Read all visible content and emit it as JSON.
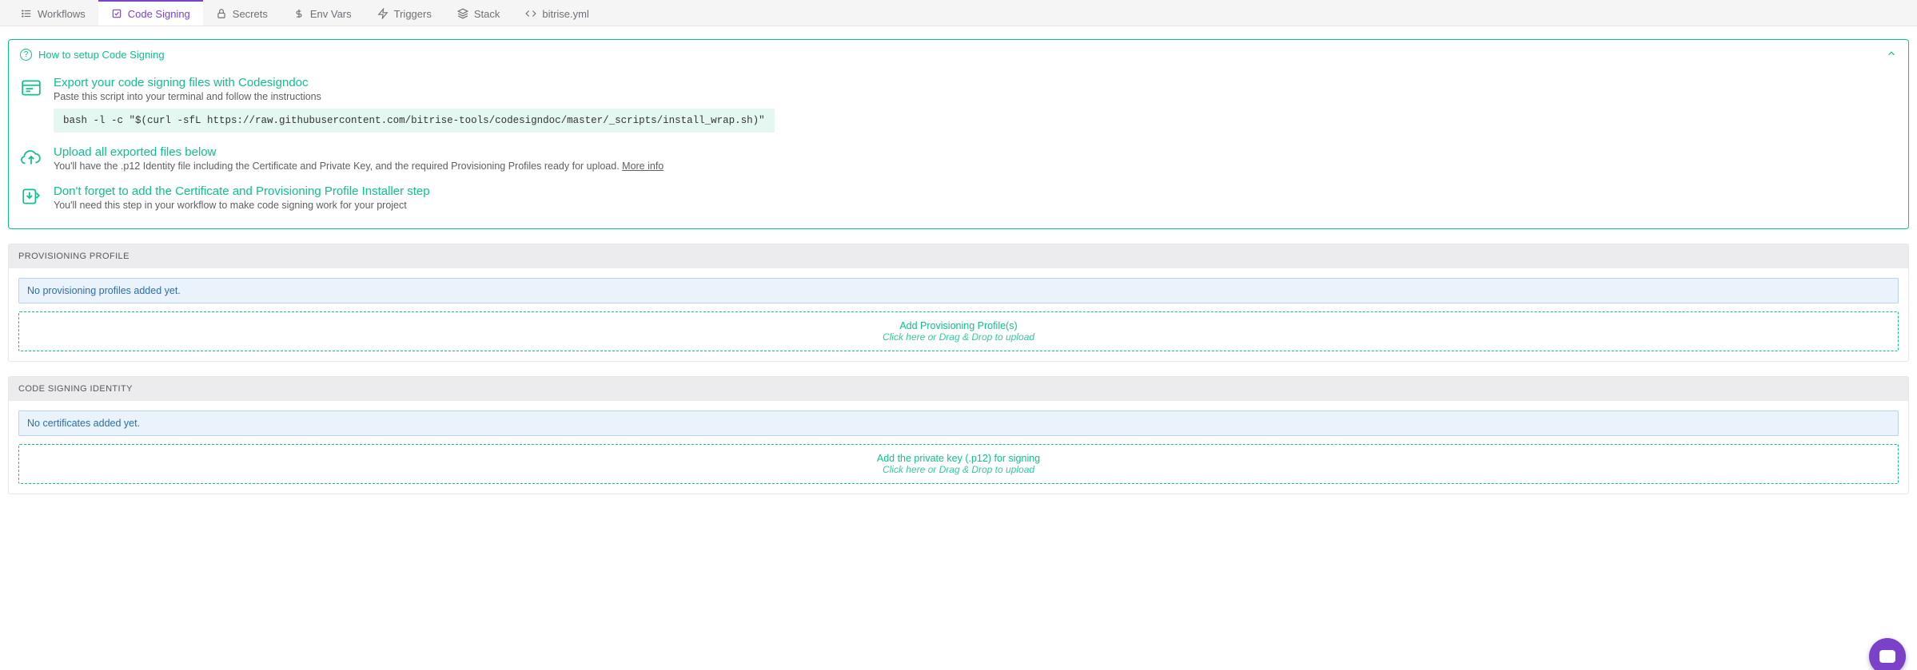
{
  "tabs": [
    {
      "label": "Workflows"
    },
    {
      "label": "Code Signing"
    },
    {
      "label": "Secrets"
    },
    {
      "label": "Env Vars"
    },
    {
      "label": "Triggers"
    },
    {
      "label": "Stack"
    },
    {
      "label": "bitrise.yml"
    }
  ],
  "info": {
    "header": "How to setup Code Signing",
    "steps": [
      {
        "title": "Export your code signing files with Codesigndoc",
        "desc": "Paste this script into your terminal and follow the instructions",
        "code": "bash -l -c \"$(curl -sfL https://raw.githubusercontent.com/bitrise-tools/codesigndoc/master/_scripts/install_wrap.sh)\""
      },
      {
        "title": "Upload all exported files below",
        "desc": "You'll have the .p12 Identity file including the Certificate and Private Key, and the required Provisioning Profiles ready for upload. ",
        "more": "More info"
      },
      {
        "title": "Don't forget to add the Certificate and Provisioning Profile Installer step",
        "desc": "You'll need this step in your workflow to make code signing work for your project"
      }
    ]
  },
  "provisioning": {
    "header": "PROVISIONING PROFILE",
    "empty": "No provisioning profiles added yet.",
    "dropzone_title": "Add Provisioning Profile(s)",
    "dropzone_sub": "Click here or Drag & Drop to upload"
  },
  "identity": {
    "header": "CODE SIGNING IDENTITY",
    "empty": "No certificates added yet.",
    "dropzone_title": "Add the private key (.p12) for signing",
    "dropzone_sub": "Click here or Drag & Drop to upload"
  }
}
